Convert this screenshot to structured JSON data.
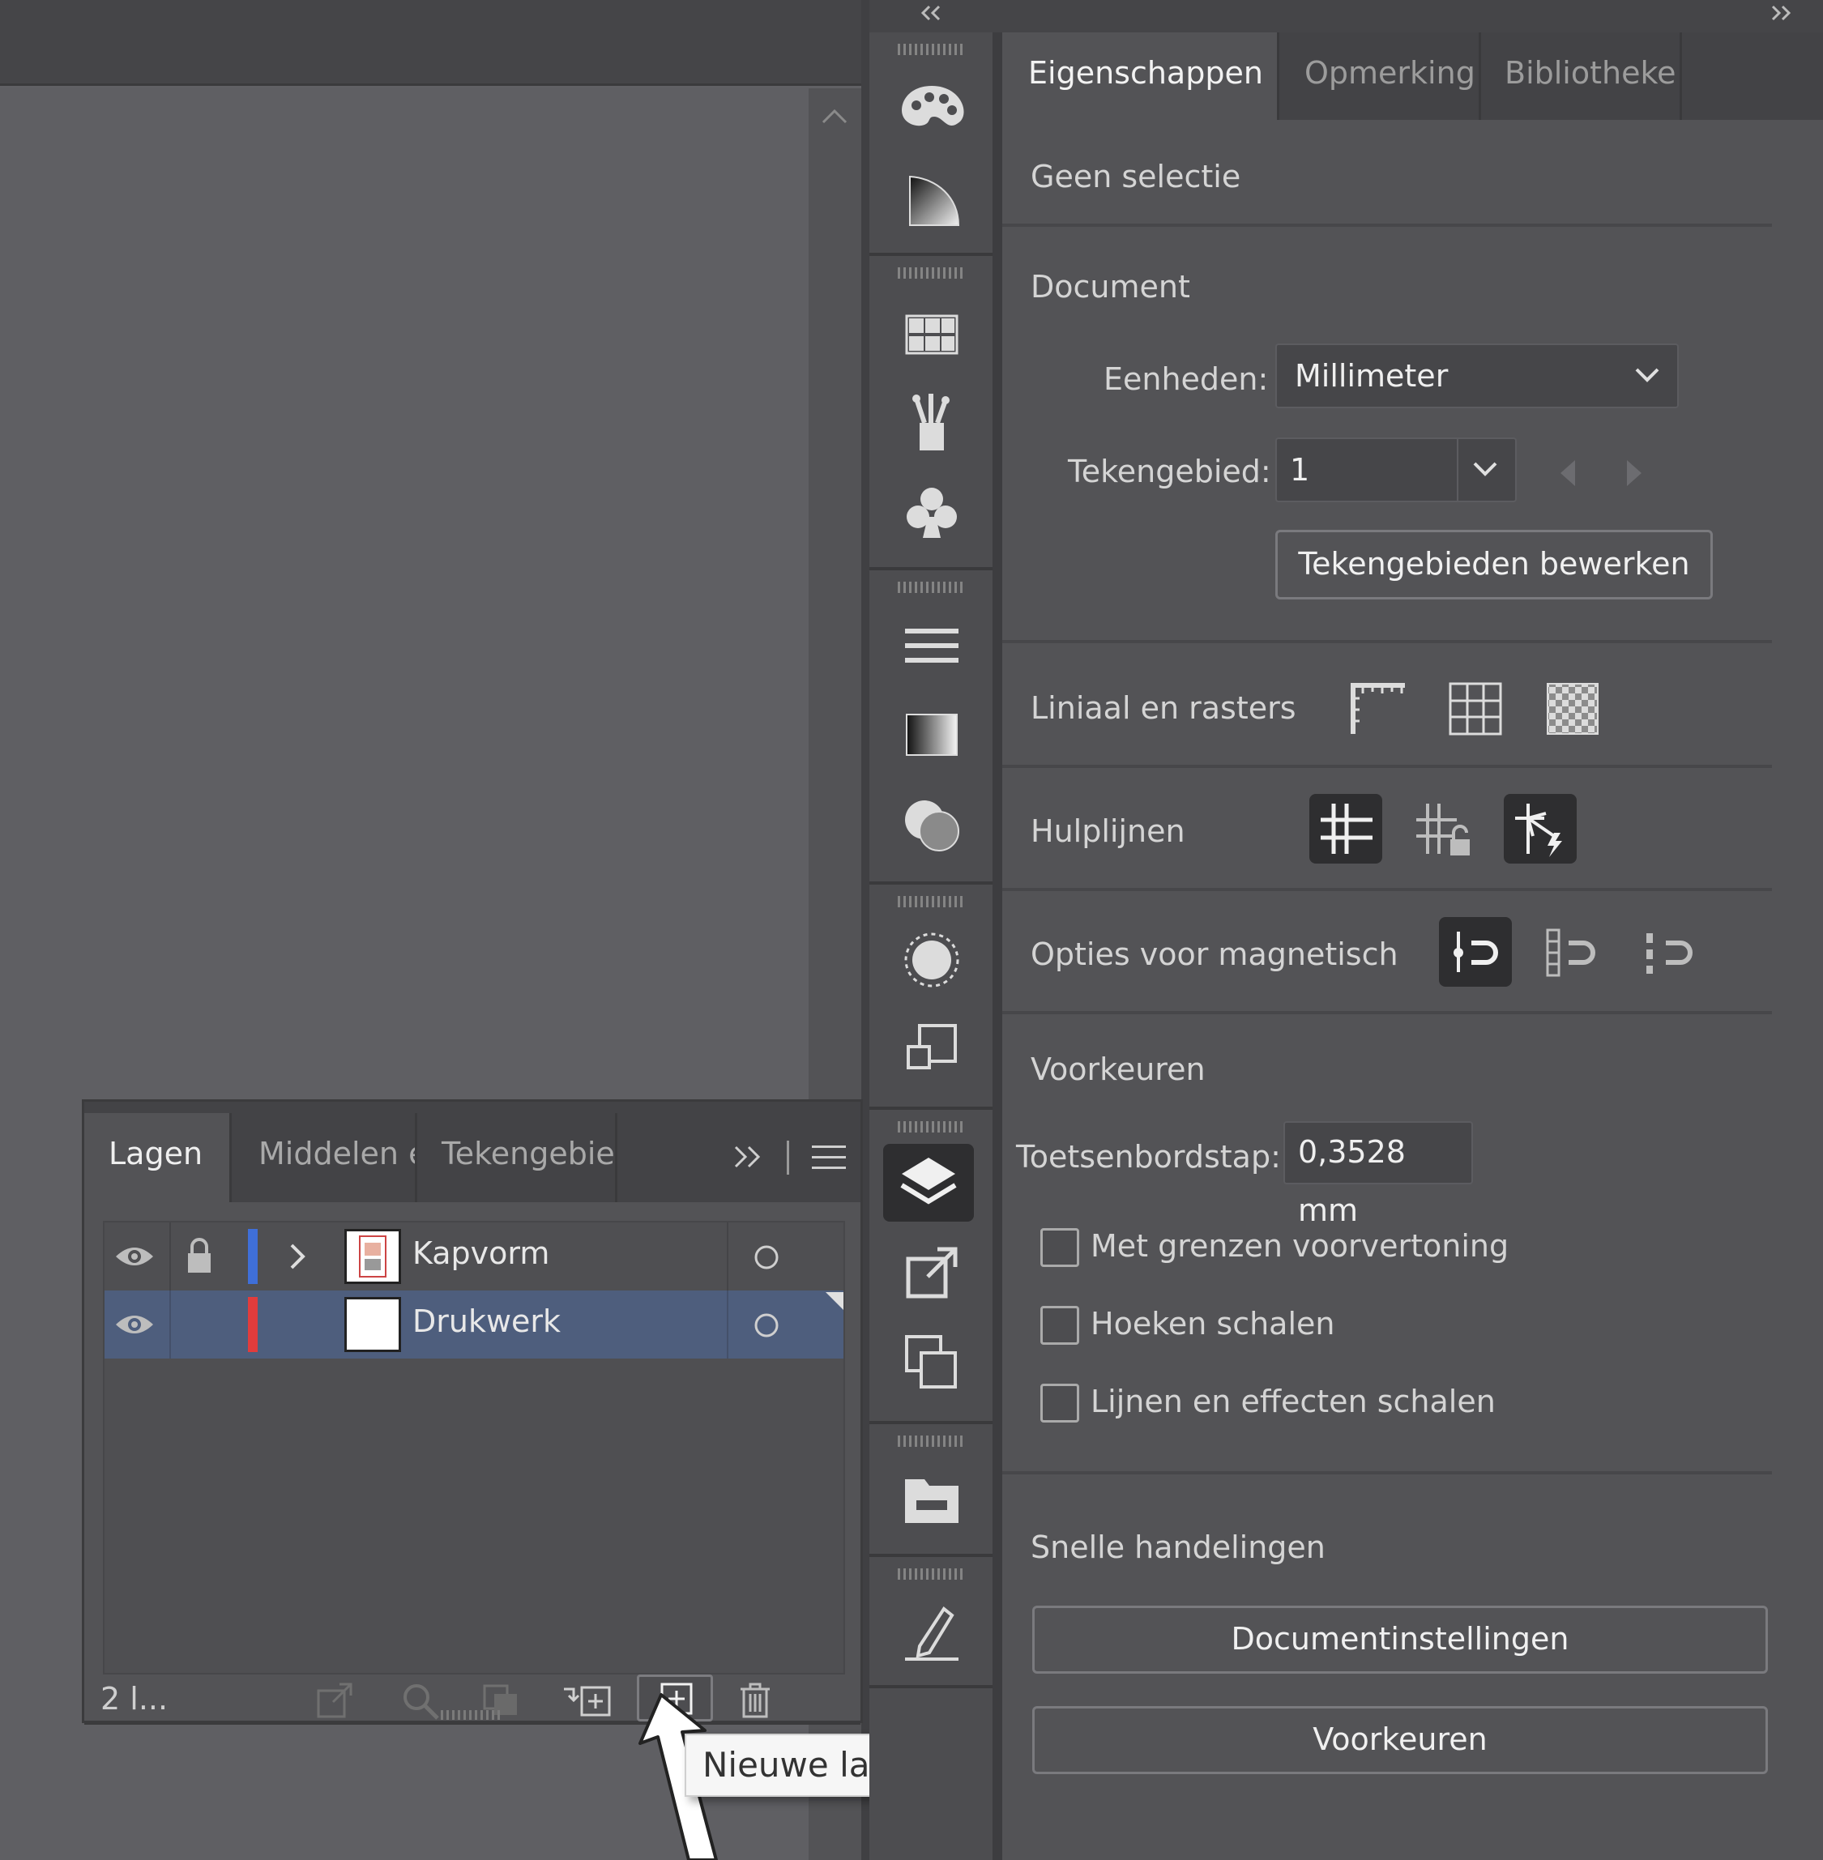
{
  "properties_panel": {
    "tabs": [
      {
        "label": "Eigenschappen",
        "active": true
      },
      {
        "label": "Opmerking",
        "active": false
      },
      {
        "label": "Bibliotheke",
        "active": false
      }
    ],
    "no_selection": "Geen selectie",
    "document": {
      "heading": "Document",
      "units_label": "Eenheden:",
      "units_value": "Millimeter",
      "artboard_label": "Tekengebied:",
      "artboard_value": "1",
      "edit_artboards_button": "Tekengebieden bewerken"
    },
    "rulers_grids_label": "Liniaal en rasters",
    "guides_label": "Hulplijnen",
    "snap_options_label": "Opties voor magnetisch",
    "preferences": {
      "heading": "Voorkeuren",
      "keyboard_increment_label": "Toetsenbordstap:",
      "keyboard_increment_value": "0,3528 mm",
      "checkboxes": [
        {
          "label": "Met grenzen voorvertoning",
          "checked": false
        },
        {
          "label": "Hoeken schalen",
          "checked": false
        },
        {
          "label": "Lijnen en effecten schalen",
          "checked": false
        }
      ]
    },
    "quick_actions": {
      "heading": "Snelle handelingen",
      "document_settings_button": "Documentinstellingen",
      "preferences_button": "Voorkeuren"
    }
  },
  "layers_panel": {
    "tabs": [
      {
        "label": "Lagen",
        "active": true
      },
      {
        "label": "Middelen ex",
        "active": false
      },
      {
        "label": "Tekengebied",
        "active": false
      }
    ],
    "layers": [
      {
        "name": "Kapvorm",
        "color": "#3f6fd8",
        "locked": true,
        "visible": true,
        "selected": false
      },
      {
        "name": "Drukwerk",
        "color": "#e23c3c",
        "locked": false,
        "visible": true,
        "selected": true
      }
    ],
    "layer_count": "2 l..."
  },
  "tooltip": {
    "text": "Nieuwe laag maken"
  },
  "colors": {
    "selection_blue": "#4e5e7d",
    "panel_bg": "#535356",
    "canvas_bg": "#5f5f63"
  }
}
